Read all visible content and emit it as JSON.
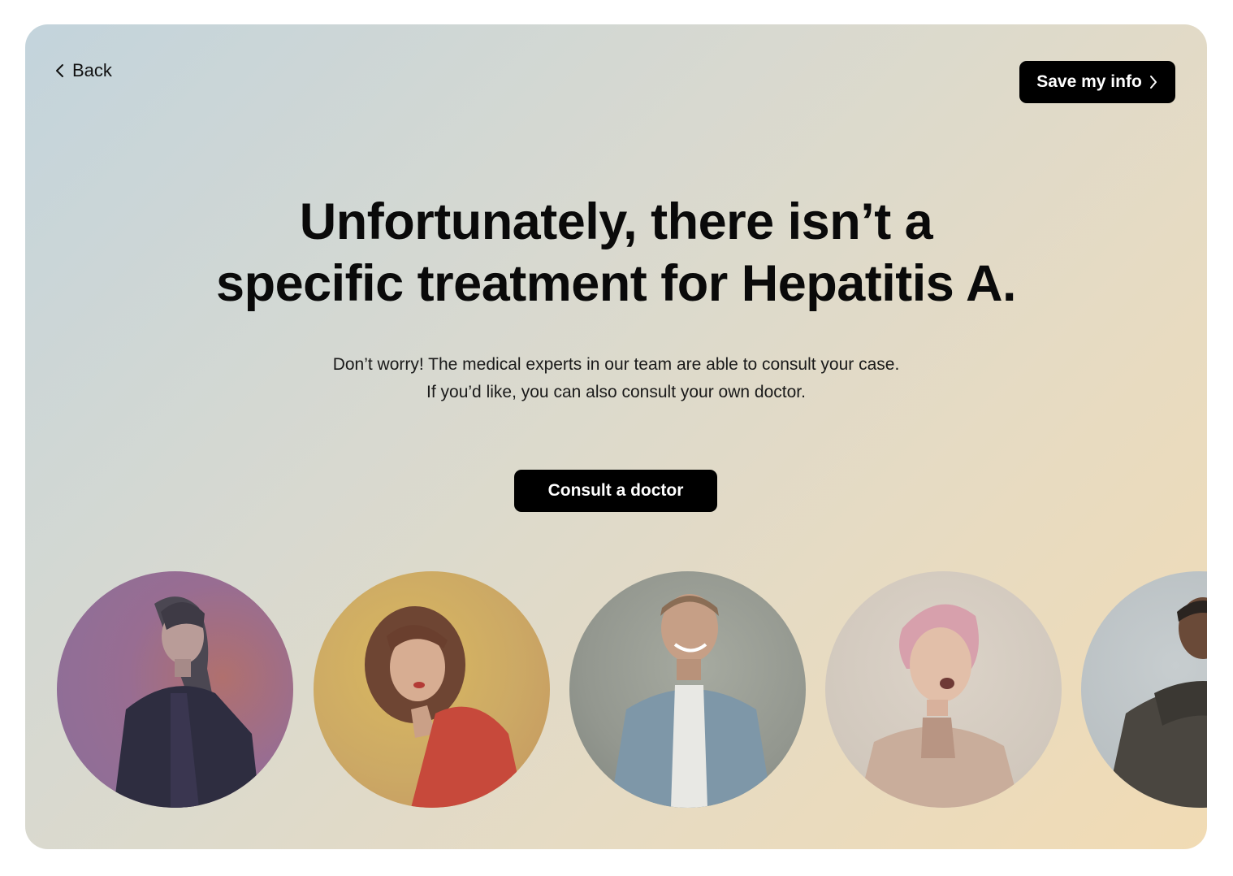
{
  "nav": {
    "back_label": "Back"
  },
  "header": {
    "save_label": "Save my info"
  },
  "main": {
    "headline_line1": "Unfortunately, there isn’t a",
    "headline_line2": "specific treatment for Hepatitis A.",
    "subtext_line1": "Don’t worry! The medical experts in our team are able to consult your case.",
    "subtext_line2": "If you’d like, you can also consult your own doctor.",
    "cta_label": "Consult a doctor"
  },
  "colors": {
    "button_bg": "#000000",
    "button_text": "#ffffff",
    "gradient_start": "#c3d4dc",
    "gradient_end": "#f1dbb4"
  },
  "doctors": [
    {
      "icon": "person-photo"
    },
    {
      "icon": "person-photo"
    },
    {
      "icon": "person-photo"
    },
    {
      "icon": "person-photo"
    },
    {
      "icon": "person-photo"
    }
  ]
}
